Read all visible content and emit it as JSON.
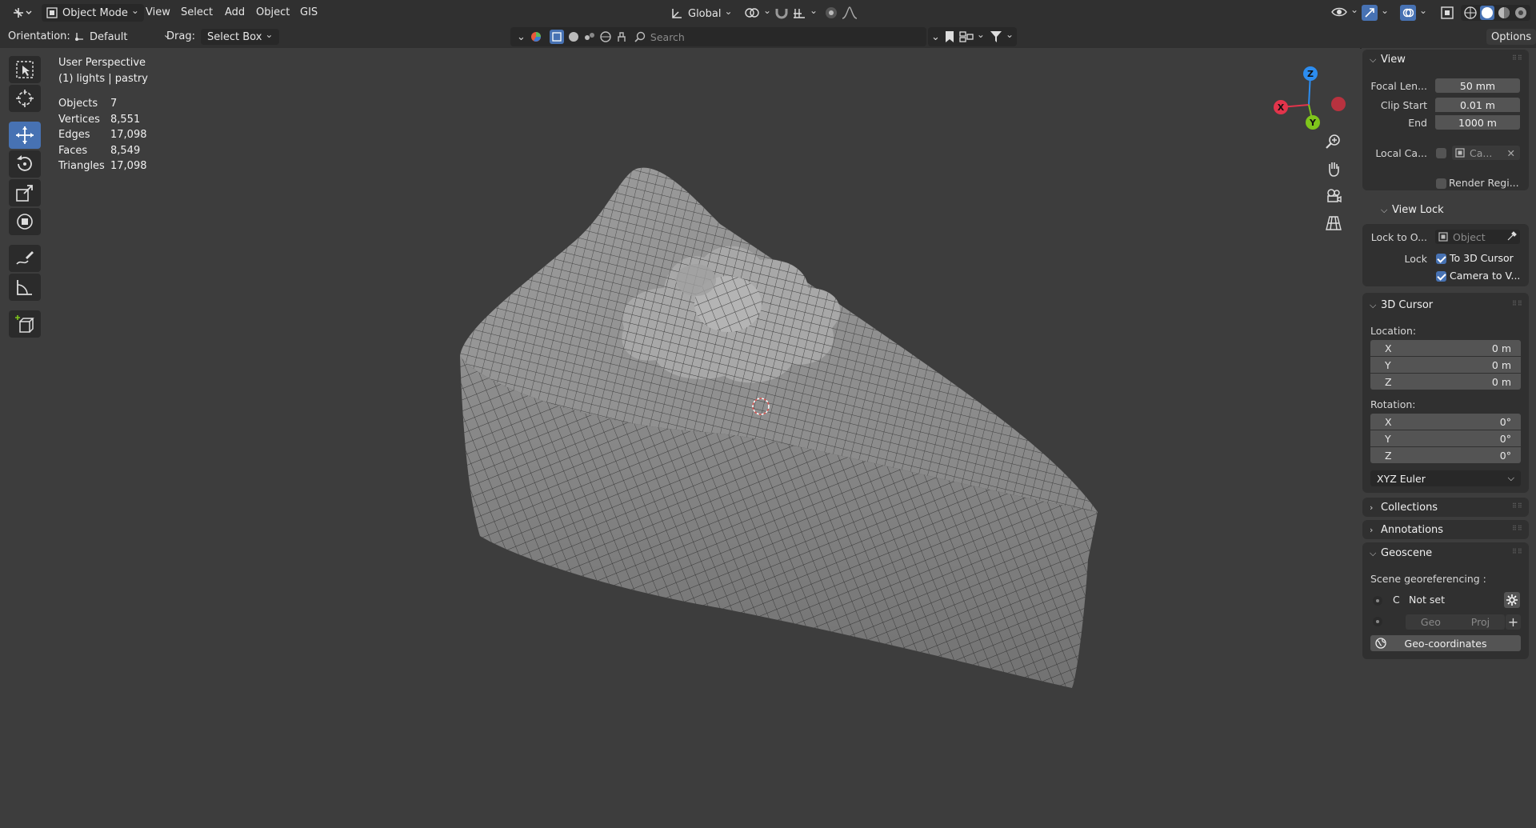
{
  "header": {
    "mode": "Object Mode",
    "menus": [
      "View",
      "Select",
      "Add",
      "Object",
      "GIS"
    ],
    "transform_orientation": "Global",
    "options_label": "Options"
  },
  "toolheader": {
    "orientation_label": "Orientation:",
    "orientation_value": "Default",
    "drag_label": "Drag:",
    "drag_value": "Select Box",
    "search_placeholder": "Search"
  },
  "overlay": {
    "view_name": "User Perspective",
    "collection_object": "(1) lights | pastry",
    "stats": [
      {
        "label": "Objects",
        "value": "7"
      },
      {
        "label": "Vertices",
        "value": "8,551"
      },
      {
        "label": "Edges",
        "value": "17,098"
      },
      {
        "label": "Faces",
        "value": "8,549"
      },
      {
        "label": "Triangles",
        "value": "17,098"
      }
    ]
  },
  "gizmo": {
    "z": "Z",
    "x": "X",
    "y": "Y"
  },
  "npanel": {
    "view": {
      "title": "View",
      "focal_label": "Focal Len...",
      "focal_value": "50 mm",
      "clip_start_label": "Clip Start",
      "clip_start_value": "0.01 m",
      "end_label": "End",
      "end_value": "1000 m",
      "local_camera_label": "Local Ca...",
      "local_camera_value": "Ca...",
      "render_region_label": "Render Regi..."
    },
    "view_lock": {
      "title": "View Lock",
      "lock_to_label": "Lock to O...",
      "lock_to_placeholder": "Object",
      "lock_label": "Lock",
      "to_cursor": "To 3D Cursor",
      "camera_to_view": "Camera to V..."
    },
    "cursor": {
      "title": "3D Cursor",
      "location_label": "Location:",
      "location": [
        {
          "axis": "X",
          "value": "0 m"
        },
        {
          "axis": "Y",
          "value": "0 m"
        },
        {
          "axis": "Z",
          "value": "0 m"
        }
      ],
      "rotation_label": "Rotation:",
      "rotation": [
        {
          "axis": "X",
          "value": "0°"
        },
        {
          "axis": "Y",
          "value": "0°"
        },
        {
          "axis": "Z",
          "value": "0°"
        }
      ],
      "rotation_mode": "XYZ Euler"
    },
    "collections_title": "Collections",
    "annotations_title": "Annotations",
    "geoscene": {
      "title": "Geoscene",
      "georef_label": "Scene georeferencing :",
      "crs_prefix": "C",
      "crs_value": "Not set",
      "geo_label": "Geo",
      "proj_label": "Proj",
      "geo_coordinates": "Geo-coordinates"
    }
  },
  "colors": {
    "accent": "#4772b3",
    "axis_x": "#e2344b",
    "axis_y": "#7fc61b",
    "axis_z": "#2c8df0"
  }
}
